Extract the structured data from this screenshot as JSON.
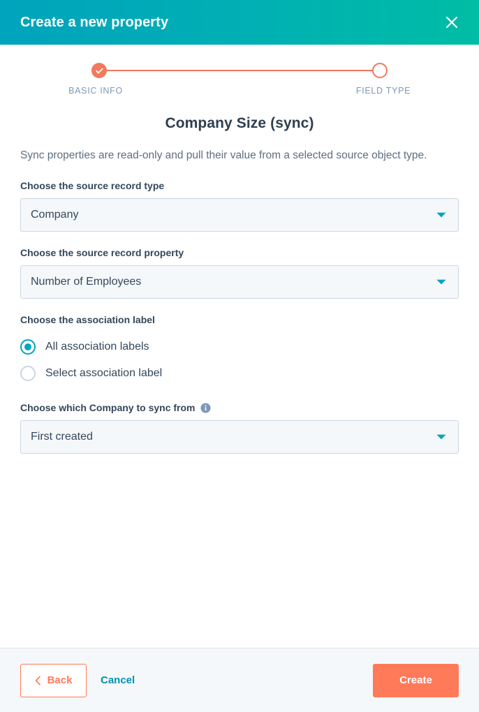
{
  "header": {
    "title": "Create a new property",
    "close_icon": "close-icon",
    "gradient_from": "#00a3bc",
    "gradient_to": "#00bda5"
  },
  "stepper": {
    "accent_color": "#f2795b",
    "steps": [
      {
        "label": "BASIC INFO",
        "state": "complete",
        "icon": "check-icon"
      },
      {
        "label": "FIELD TYPE",
        "state": "current",
        "icon": "circle-icon"
      }
    ]
  },
  "form": {
    "title": "Company Size (sync)",
    "description": "Sync properties are read-only and pull their value from a selected source object type.",
    "source_record_type": {
      "label": "Choose the source record type",
      "value": "Company",
      "caret_icon": "chevron-down-icon"
    },
    "source_record_property": {
      "label": "Choose the source record property",
      "value": "Number of Employees",
      "caret_icon": "chevron-down-icon"
    },
    "association_label": {
      "label": "Choose the association label",
      "options": [
        {
          "label": "All association labels",
          "selected": true
        },
        {
          "label": "Select association label",
          "selected": false
        }
      ]
    },
    "sync_from": {
      "label": "Choose which Company to sync from",
      "info_icon": "info-icon",
      "value": "First created",
      "caret_icon": "chevron-down-icon"
    }
  },
  "footer": {
    "back_label": "Back",
    "back_icon": "chevron-left-icon",
    "cancel_label": "Cancel",
    "create_label": "Create",
    "primary_color": "#ff7a59",
    "link_color": "#0091ae"
  }
}
